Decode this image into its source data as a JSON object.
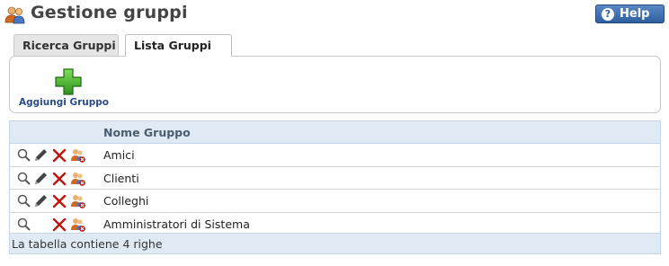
{
  "page": {
    "title": "Gestione gruppi",
    "icon": "users-icon"
  },
  "help": {
    "label": "Help",
    "icon": "question-icon"
  },
  "tabs": [
    {
      "label": "Ricerca Gruppi",
      "active": false
    },
    {
      "label": "Lista Gruppi",
      "active": true
    }
  ],
  "toolbar": {
    "add_label": "Aggiungi Gruppo",
    "add_icon": "plus-icon"
  },
  "table": {
    "columns": [
      "",
      "Nome Gruppo"
    ],
    "rows": [
      {
        "name": "Amici",
        "actions": [
          "view",
          "edit",
          "delete",
          "members"
        ]
      },
      {
        "name": "Clienti",
        "actions": [
          "view",
          "edit",
          "delete",
          "members"
        ]
      },
      {
        "name": "Colleghi",
        "actions": [
          "view",
          "edit",
          "delete",
          "members"
        ]
      },
      {
        "name": "Amministratori di Sistema",
        "actions": [
          "view",
          "delete",
          "members"
        ]
      }
    ],
    "footer": "La tabella contiene 4 righe"
  },
  "colors": {
    "accent": "#2f5f9e",
    "header_bg": "#dfeaf5",
    "add_green": "#3fa62a",
    "delete_red": "#c0140c"
  }
}
